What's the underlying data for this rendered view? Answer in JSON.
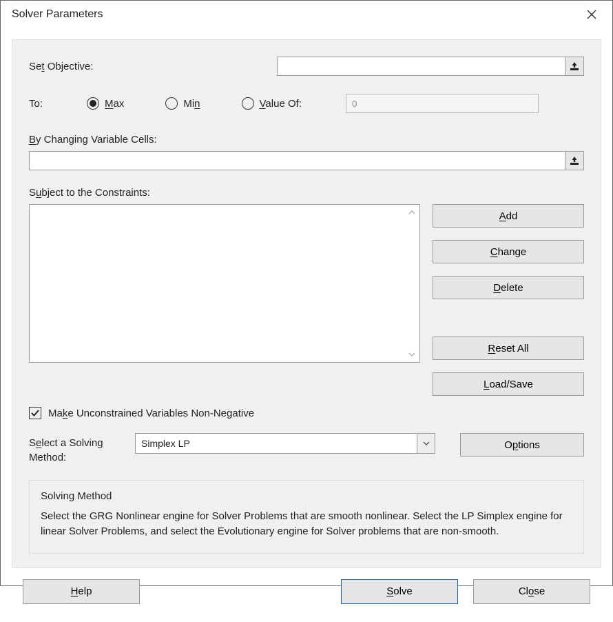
{
  "title": "Solver Parameters",
  "setObjective": {
    "label_pre": "Se",
    "label_u": "t",
    "label_post": " Objective:",
    "value": ""
  },
  "to": {
    "label": "To:",
    "max": {
      "pre": "",
      "u": "M",
      "post": "ax"
    },
    "min": {
      "pre": "Mi",
      "u": "n",
      "post": ""
    },
    "valueOf": {
      "pre": "",
      "u": "V",
      "post": "alue Of:"
    },
    "valueOfInput": "0",
    "selected": "max"
  },
  "byChanging": {
    "pre": "",
    "u": "B",
    "post": "y Changing Variable Cells:",
    "value": ""
  },
  "constraints": {
    "label_pre": "S",
    "label_u": "u",
    "label_post": "bject to the Constraints:",
    "buttons": {
      "add": {
        "pre": "",
        "u": "A",
        "post": "dd"
      },
      "change": {
        "pre": "",
        "u": "C",
        "post": "hange"
      },
      "delete": {
        "pre": "",
        "u": "D",
        "post": "elete"
      },
      "reset": {
        "pre": "",
        "u": "R",
        "post": "eset All"
      },
      "loadsave": {
        "pre": "",
        "u": "L",
        "post": "oad/Save"
      }
    }
  },
  "checkbox": {
    "pre": "Ma",
    "u": "k",
    "post": "e Unconstrained Variables Non-Negative",
    "checked": true
  },
  "method": {
    "label_pre": "S",
    "label_u": "e",
    "label_post": "lect a Solving Method:",
    "selected": "Simplex LP",
    "options_pre": "O",
    "options_u": "p",
    "options_post": "tions"
  },
  "desc": {
    "title": "Solving Method",
    "text": "Select the GRG Nonlinear engine for Solver Problems that are smooth nonlinear. Select the LP Simplex engine for linear Solver Problems, and select the Evolutionary engine for Solver problems that are non-smooth."
  },
  "footer": {
    "help": {
      "pre": "",
      "u": "H",
      "post": "elp"
    },
    "solve": {
      "pre": "",
      "u": "S",
      "post": "olve"
    },
    "close": {
      "pre": "Cl",
      "u": "o",
      "post": "se"
    }
  }
}
